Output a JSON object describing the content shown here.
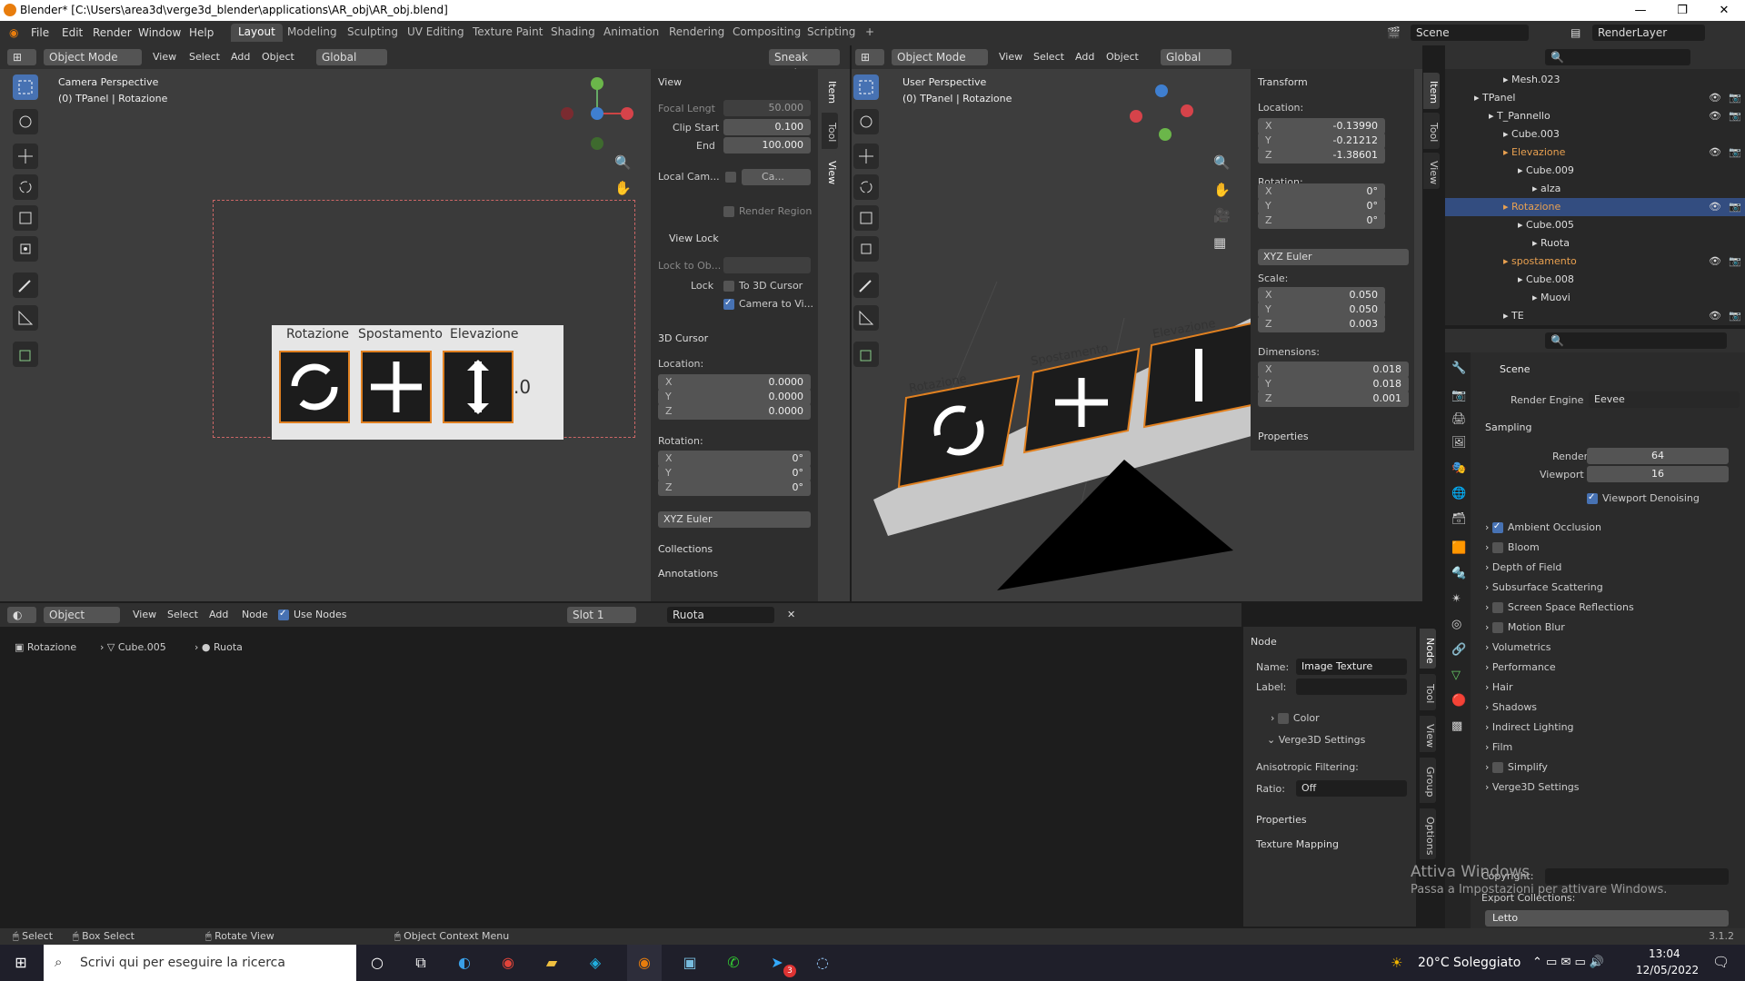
{
  "titlebar": {
    "title": "Blender* [C:\\Users\\area3d\\verge3d_blender\\applications\\AR_obj\\AR_obj.blend]",
    "minimize": "—",
    "maximize": "❐",
    "close": "✕"
  },
  "menu": [
    "File",
    "Edit",
    "Render",
    "Window",
    "Help"
  ],
  "workspaces": [
    "Layout",
    "Modeling",
    "Sculpting",
    "UV Editing",
    "Texture Paint",
    "Shading",
    "Animation",
    "Rendering",
    "Compositing",
    "Scripting"
  ],
  "add_tab": "+",
  "scene": {
    "scene_name": "Scene",
    "view_layer": "RenderLayer"
  },
  "vp_left": {
    "mode": "Object Mode",
    "menus": [
      "View",
      "Select",
      "Add",
      "Object"
    ],
    "orientation": "Global",
    "sneak": "Sneak Peek",
    "title": "Camera Perspective",
    "subtitle": "(0) TPanel | Rotazione"
  },
  "panel_labels": [
    "Rotazione",
    "Spostamento",
    "Elevazione"
  ],
  "panel_tail": ".0",
  "view_panel": {
    "view": "View",
    "focal_label": "Focal Lengt",
    "focal_value": "50.000",
    "clip_start_label": "Clip Start",
    "clip_start": "0.100",
    "end_label": "End",
    "end": "100.000",
    "local_cam_label": "Local Cam...",
    "local_cam_value": "Ca...",
    "render_region": "Render Region",
    "view_lock": "View Lock",
    "lock_to_obj": "Lock to Ob...",
    "lock_label": "Lock",
    "to_3d_cursor": "To 3D Cursor",
    "camera_to_view": "Camera to Vi...",
    "cursor": "3D Cursor",
    "location": "Location:",
    "loc": [
      {
        "ax": "X",
        "v": "0.0000"
      },
      {
        "ax": "Y",
        "v": "0.0000"
      },
      {
        "ax": "Z",
        "v": "0.0000"
      }
    ],
    "rotation": "Rotation:",
    "rot": [
      {
        "ax": "X",
        "v": "0°"
      },
      {
        "ax": "Y",
        "v": "0°"
      },
      {
        "ax": "Z",
        "v": "0°"
      }
    ],
    "euler": "XYZ Euler",
    "collections": "Collections",
    "annotations": "Annotations"
  },
  "side_tabs": [
    "Item",
    "Tool",
    "View"
  ],
  "vp_right": {
    "mode": "Object Mode",
    "menus": [
      "View",
      "Select",
      "Add",
      "Object"
    ],
    "orientation": "Global",
    "title": "User Perspective",
    "subtitle": "(0) TPanel | Rotazione"
  },
  "transform": {
    "header": "Transform",
    "location": "Location:",
    "loc": [
      {
        "ax": "X",
        "v": "-0.13990"
      },
      {
        "ax": "Y",
        "v": "-0.21212"
      },
      {
        "ax": "Z",
        "v": "-1.38601"
      }
    ],
    "rotation": "Rotation:",
    "rot": [
      {
        "ax": "X",
        "v": "0°"
      },
      {
        "ax": "Y",
        "v": "0°"
      },
      {
        "ax": "Z",
        "v": "0°"
      }
    ],
    "euler": "XYZ Euler",
    "scale": "Scale:",
    "sca": [
      {
        "ax": "X",
        "v": "0.050"
      },
      {
        "ax": "Y",
        "v": "0.050"
      },
      {
        "ax": "Z",
        "v": "0.003"
      }
    ],
    "dimensions": "Dimensions:",
    "dim": [
      {
        "ax": "X",
        "v": "0.018"
      },
      {
        "ax": "Y",
        "v": "0.018"
      },
      {
        "ax": "Z",
        "v": "0.001"
      }
    ],
    "properties": "Properties"
  },
  "outliner": [
    {
      "label": "Mesh.023",
      "indent": 4,
      "sel": false,
      "hl": false,
      "eye": false
    },
    {
      "label": "TPanel",
      "indent": 2,
      "sel": false,
      "hl": false,
      "eye": true
    },
    {
      "label": "T_Pannello",
      "indent": 3,
      "sel": false,
      "hl": false,
      "eye": true
    },
    {
      "label": "Cube.003",
      "indent": 4,
      "sel": false,
      "hl": false,
      "eye": false
    },
    {
      "label": "Elevazione",
      "indent": 4,
      "sel": false,
      "hl": true,
      "eye": true
    },
    {
      "label": "Cube.009",
      "indent": 5,
      "sel": false,
      "hl": false,
      "eye": false
    },
    {
      "label": "alza",
      "indent": 6,
      "sel": false,
      "hl": false,
      "eye": false
    },
    {
      "label": "Rotazione",
      "indent": 4,
      "sel": true,
      "hl": true,
      "eye": true
    },
    {
      "label": "Cube.005",
      "indent": 5,
      "sel": false,
      "hl": false,
      "eye": false
    },
    {
      "label": "Ruota",
      "indent": 6,
      "sel": false,
      "hl": false,
      "eye": false
    },
    {
      "label": "spostamento",
      "indent": 4,
      "sel": false,
      "hl": true,
      "eye": true
    },
    {
      "label": "Cube.008",
      "indent": 5,
      "sel": false,
      "hl": false,
      "eye": false
    },
    {
      "label": "Muovi",
      "indent": 6,
      "sel": false,
      "hl": false,
      "eye": false
    },
    {
      "label": "TE",
      "indent": 4,
      "sel": false,
      "hl": false,
      "eye": true
    }
  ],
  "props": {
    "scene": "Scene",
    "render_engine_label": "Render Engine",
    "render_engine": "Eevee",
    "sampling": "Sampling",
    "render_label": "Render",
    "render_value": "64",
    "viewport_label": "Viewport",
    "viewport_value": "16",
    "denoise": "Viewport Denoising",
    "sections": [
      {
        "label": "Ambient Occlusion",
        "chk": "on"
      },
      {
        "label": "Bloom",
        "chk": "off"
      },
      {
        "label": "Depth of Field",
        "chk": "none"
      },
      {
        "label": "Subsurface Scattering",
        "chk": "none"
      },
      {
        "label": "Screen Space Reflections",
        "chk": "off"
      },
      {
        "label": "Motion Blur",
        "chk": "off"
      },
      {
        "label": "Volumetrics",
        "chk": "none"
      },
      {
        "label": "Performance",
        "chk": "none"
      },
      {
        "label": "Hair",
        "chk": "none"
      },
      {
        "label": "Shadows",
        "chk": "none"
      },
      {
        "label": "Indirect Lighting",
        "chk": "none"
      },
      {
        "label": "Film",
        "chk": "none"
      },
      {
        "label": "Simplify",
        "chk": "off"
      },
      {
        "label": "Verge3D Settings",
        "chk": "none"
      }
    ],
    "copyright": "Copyright:",
    "export_collections": "Export Collections:",
    "letto": "Letto"
  },
  "node_editor": {
    "object": "Object",
    "menus": [
      "View",
      "Select",
      "Add",
      "Node"
    ],
    "use_nodes": "Use Nodes",
    "slot": "Slot 1",
    "material": "Ruota",
    "breadcrumb": [
      "Rotazione",
      "Cube.005",
      "Ruota"
    ]
  },
  "node_panel": {
    "header": "Node",
    "name_label": "Name:",
    "name_value": "Image Texture",
    "label_label": "Label:",
    "color": "Color",
    "verge": "Verge3D Settings",
    "aniso": "Anisotropic Filtering:",
    "ratio_label": "Ratio:",
    "ratio": "Off",
    "properties": "Properties",
    "texture_mapping": "Texture Mapping"
  },
  "node_tabs": [
    "Node",
    "Tool",
    "View",
    "Group",
    "Options"
  ],
  "activate": {
    "line1": "Attiva Windows",
    "line2": "Passa a Impostazioni per attivare Windows."
  },
  "statusbar": {
    "select": "Select",
    "box_select": "Box Select",
    "rotate_view": "Rotate View",
    "context_menu": "Object Context Menu",
    "version": "3.1.2"
  },
  "taskbar": {
    "search": "Scrivi qui per eseguire la ricerca",
    "weather": "20°C  Soleggiato",
    "time": "13:04",
    "date": "12/05/2022",
    "badge": "3"
  }
}
